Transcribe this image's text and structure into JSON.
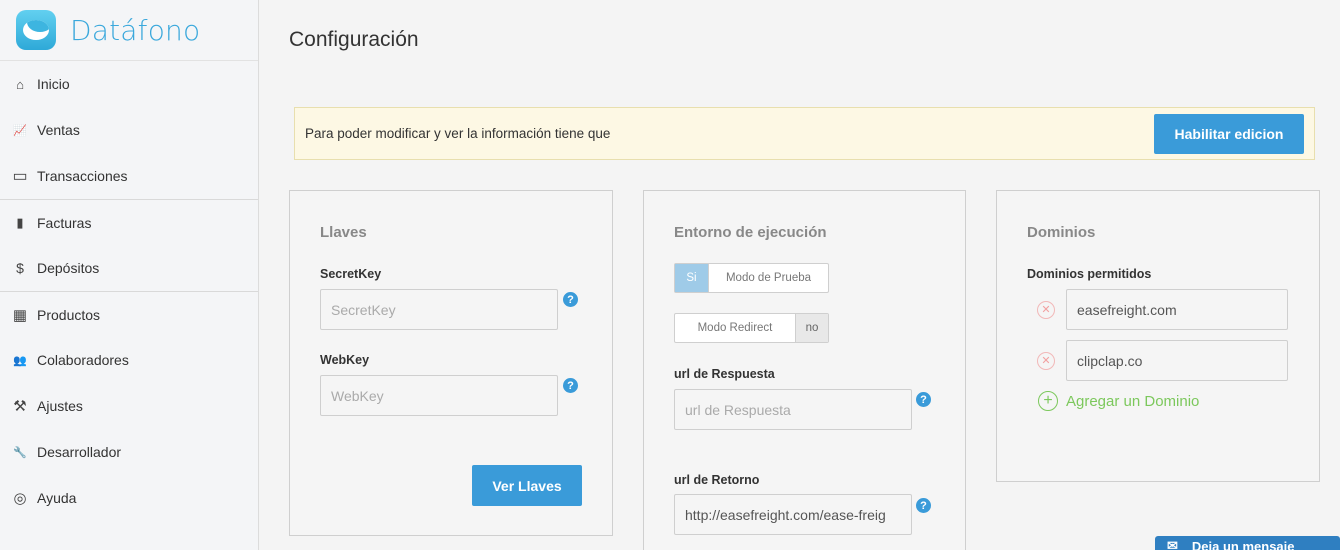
{
  "brand": {
    "name": "Datáfono"
  },
  "sidebar": {
    "items": [
      {
        "label": "Inicio",
        "icon": "home-icon",
        "glyph": "⌂"
      },
      {
        "label": "Ventas",
        "icon": "area-chart-icon",
        "glyph": "📈"
      },
      {
        "label": "Transacciones",
        "icon": "credit-card-icon",
        "glyph": "▭"
      },
      {
        "label": "Facturas",
        "icon": "file-icon",
        "glyph": "▮"
      },
      {
        "label": "Depósitos",
        "icon": "dollar-icon",
        "glyph": "$"
      },
      {
        "label": "Productos",
        "icon": "grid-icon",
        "glyph": "▦"
      },
      {
        "label": "Colaboradores",
        "icon": "users-icon",
        "glyph": "👥"
      },
      {
        "label": "Ajustes",
        "icon": "tools-icon",
        "glyph": "⚒"
      },
      {
        "label": "Desarrollador",
        "icon": "wrench-icon",
        "glyph": "🔧"
      },
      {
        "label": "Ayuda",
        "icon": "life-ring-icon",
        "glyph": "◎"
      }
    ]
  },
  "page": {
    "title": "Configuración"
  },
  "alert": {
    "text": "Para poder modificar y ver la información tiene que",
    "button": "Habilitar edicion"
  },
  "llaves": {
    "title": "Llaves",
    "secret_label": "SecretKey",
    "secret_placeholder": "SecretKey",
    "web_label": "WebKey",
    "web_placeholder": "WebKey",
    "button": "Ver Llaves"
  },
  "entorno": {
    "title": "Entorno de ejecución",
    "toggle1_on": "Si",
    "toggle1_off": "Modo de Prueba",
    "toggle2_off": "Modo Redirect",
    "toggle2_no": "no",
    "respuesta_label": "url de Respuesta",
    "respuesta_placeholder": "url de Respuesta",
    "retorno_label": "url de Retorno",
    "retorno_value": "http://easefreight.com/ease-freig"
  },
  "dominios": {
    "title": "Dominios",
    "label": "Dominios permitidos",
    "items": [
      "easefreight.com",
      "clipclap.co"
    ],
    "add_label": "Agregar un Dominio"
  },
  "chat": {
    "label": "Deja un mensaje"
  },
  "help_glyph": "?",
  "colors": {
    "accent": "#3a9bd9",
    "brand": "#3aa8dc",
    "success": "#7cc85c",
    "alert_bg": "#fdf8e4"
  }
}
